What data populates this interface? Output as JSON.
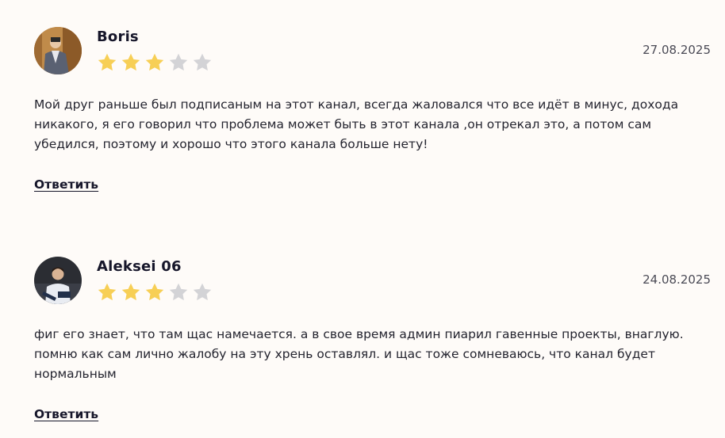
{
  "reviews": [
    {
      "author": "Boris",
      "date": "27.08.2025",
      "rating": 3,
      "max_rating": 5,
      "text": "Мой друг раньше был подписаным на этот канал, всегда жаловался что все идёт в минус, дохода никакого, я его говорил что проблема может быть в этот канала ,он отрекал это, а потом сам убедился, поэтому и хорошо что этого канала больше нету!",
      "reply_label": "Ответить"
    },
    {
      "author": "Aleksei 06",
      "date": "24.08.2025",
      "rating": 3,
      "max_rating": 5,
      "text": "фиг его знает, что там щас намечается. а в свое время админ пиарил гавенные проекты, внаглую. помню как сам лично жалобу на эту хрень оставлял. и щас тоже сомневаюсь, что канал будет нормальным",
      "reply_label": "Ответить"
    }
  ],
  "colors": {
    "star_filled": "#f7cf55",
    "star_empty": "#d3d3d6",
    "background": "#fefbf8"
  },
  "icons": {
    "star": "star-icon"
  }
}
